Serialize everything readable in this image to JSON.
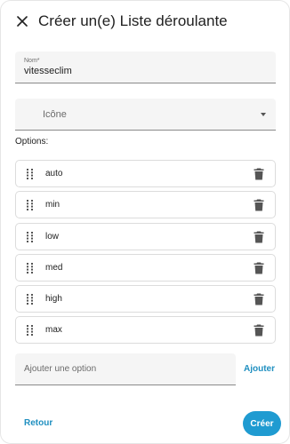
{
  "dialog": {
    "title": "Créer un(e) Liste déroulante",
    "close_icon": "close-icon"
  },
  "name_field": {
    "label": "Nom*",
    "value": "vitesseclim"
  },
  "icon_field": {
    "placeholder": "Icône",
    "dropdown_icon": "triangle-down-icon"
  },
  "options_section": {
    "label": "Options:",
    "items": [
      {
        "label": "auto"
      },
      {
        "label": "min"
      },
      {
        "label": "low"
      },
      {
        "label": "med"
      },
      {
        "label": "high"
      },
      {
        "label": "max"
      }
    ]
  },
  "add_option": {
    "placeholder": "Ajouter une option",
    "value": "",
    "button_label": "Ajouter"
  },
  "footer": {
    "back_label": "Retour",
    "create_label": "Créer"
  },
  "colors": {
    "accent": "#1f9bd1",
    "link": "#1f8fc0",
    "field_bg": "#f5f5f5"
  }
}
